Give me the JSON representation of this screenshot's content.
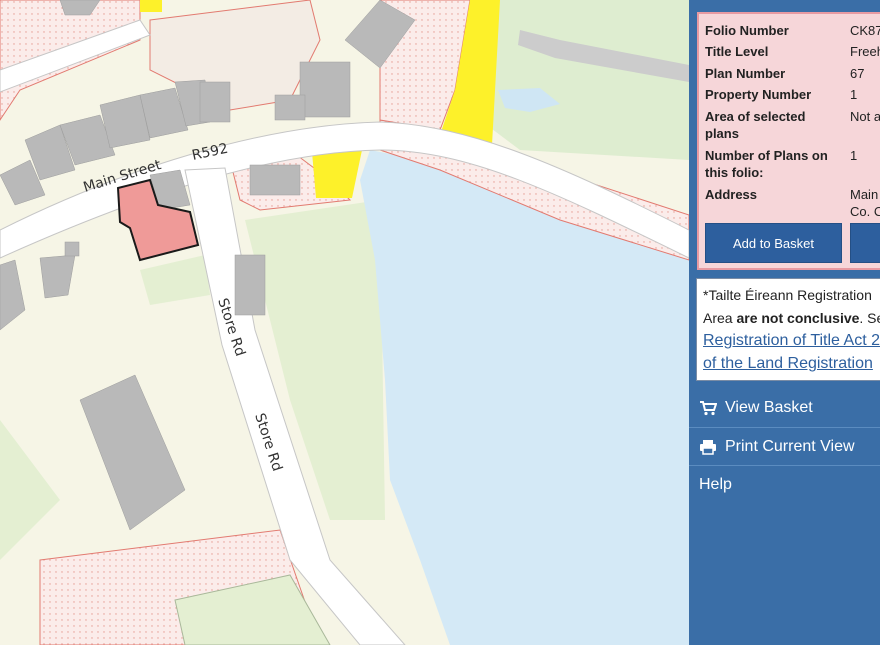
{
  "map": {
    "road_labels": {
      "main_street": "Main Street",
      "r592": "R592",
      "store_rd_upper": "Store Rd",
      "store_rd_lower": "Store Rd"
    },
    "colors": {
      "land": "#f6f5e6",
      "water": "#d4e9f6",
      "green": "#deedd0",
      "road": "#ffffff",
      "building": "#b8b8b8",
      "highlight": "#ef9a98",
      "yellow": "#fdf12a",
      "pink_outline": "#e27a70"
    }
  },
  "folio": {
    "rows": [
      {
        "label": "Folio Number",
        "value": "CK87"
      },
      {
        "label": "Title Level",
        "value": "Freeh"
      },
      {
        "label": "Plan Number",
        "value": "67"
      },
      {
        "label": "Property Number",
        "value": "1"
      },
      {
        "label": "Area of selected plans",
        "value": "Not a"
      },
      {
        "label": "Number of Plans on this folio:",
        "value": "1"
      },
      {
        "label": "Address",
        "value": "Main",
        "value2": "Co. C"
      }
    ],
    "add_to_basket": "Add to Basket",
    "second_button": ""
  },
  "note": {
    "line1": "*Tailte Éireann Registration",
    "line2_pre": "Area ",
    "line2_bold": "are not conclusive",
    "line2_post": ". Se",
    "link1": "Registration of Title Act 2",
    "link2": "of the Land Registration"
  },
  "menu": {
    "view_basket": "View Basket",
    "print_view": "Print Current View",
    "help": "Help"
  }
}
